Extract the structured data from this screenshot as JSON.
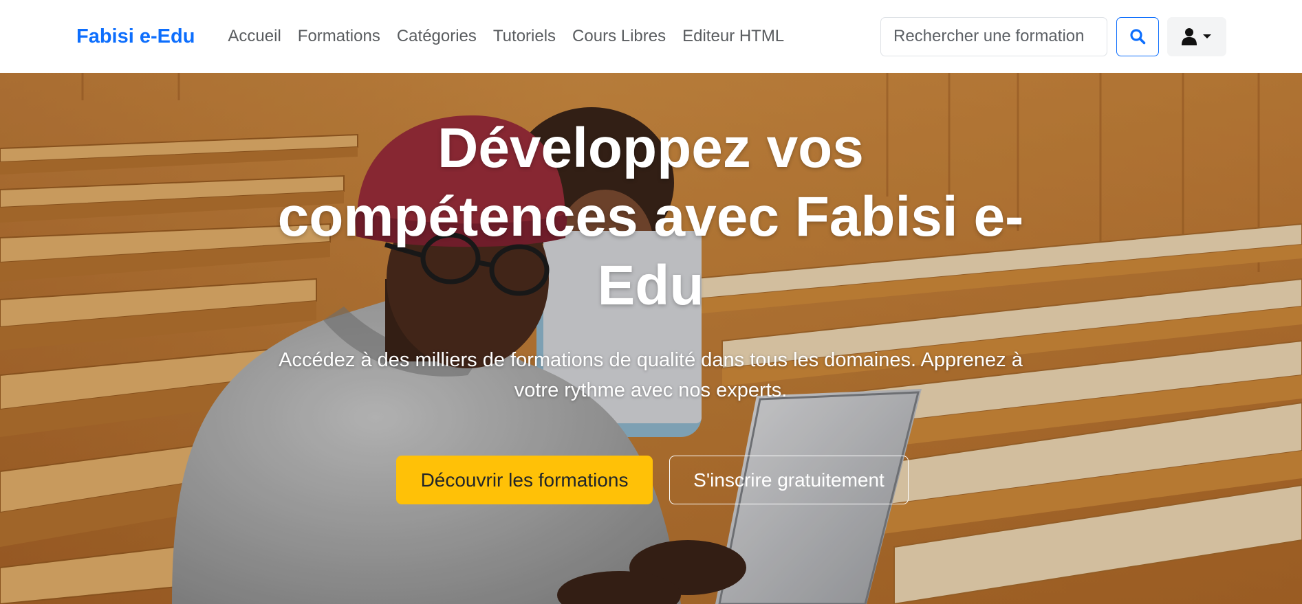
{
  "navbar": {
    "brand": "Fabisi e-Edu",
    "links": [
      "Accueil",
      "Formations",
      "Catégories",
      "Tutoriels",
      "Cours Libres",
      "Editeur HTML"
    ],
    "search": {
      "placeholder": "Rechercher une formation",
      "icon": "search-icon"
    },
    "user_menu": {
      "icon": "user-icon",
      "caret": "caret-down-icon"
    }
  },
  "hero": {
    "title": "Développez vos compétences avec Fabisi e-Edu",
    "subtitle": "Accédez à des milliers de formations de qualité dans tous les domaines. Apprenez à votre rythme avec nos experts.",
    "primary_cta": "Découvrir les formations",
    "secondary_cta": "S'inscrire gratuitement",
    "background": "photo of a student in a red beanie and glasses typing on a laptop in a lecture hall"
  },
  "colors": {
    "brand": "#0d6efd",
    "nav_text": "#595c5f",
    "cta_primary": "#ffc107",
    "hero_text": "#ffffff"
  }
}
